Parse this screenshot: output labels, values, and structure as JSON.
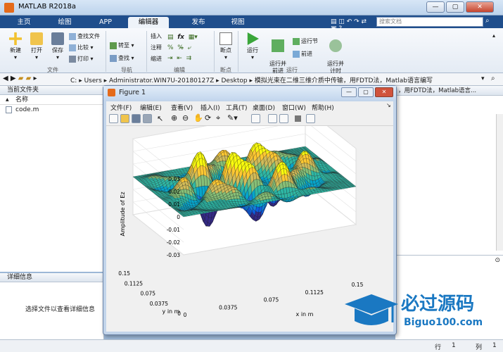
{
  "window": {
    "title": "MATLAB R2018a"
  },
  "tabs": [
    {
      "label": "主页"
    },
    {
      "label": "绘图"
    },
    {
      "label": "APP"
    },
    {
      "label": "编辑器"
    },
    {
      "label": "发布"
    },
    {
      "label": "视图"
    }
  ],
  "search": {
    "placeholder": "搜索文档"
  },
  "ribbon": {
    "file": {
      "new": "新建",
      "open": "打开",
      "save": "保存",
      "find_files": "查找文件",
      "compare": "比较",
      "print": "打印",
      "group": "文件"
    },
    "nav": {
      "goto": "转至",
      "find": "查找",
      "group": "导航"
    },
    "edit": {
      "insert": "插入",
      "comment": "注释",
      "indent": "缩进",
      "fx": "fx",
      "group": "编辑"
    },
    "breakpoints": {
      "label": "断点",
      "group": "断点"
    },
    "run": {
      "run": "运行",
      "run_advance": "运行并\n前进",
      "run_section": "运行节",
      "advance": "前进",
      "run_time": "运行并\n计时",
      "group": "运行"
    }
  },
  "address": {
    "segments": [
      "C:",
      "Users",
      "Administrator.WIN7U-20180127Z",
      "Desktop",
      "模拟光束在二维三维介质中传输，用FDTD法，Matlab语言编写"
    ]
  },
  "left_panel": {
    "title": "当前文件夹",
    "col_name": "名称",
    "sort_indicator": "▲",
    "file": "code.m",
    "details_title": "详细信息",
    "details_hint": "选择文件以查看详细信息"
  },
  "right_panel": {
    "path_suffix": "，用FDTD法，Matlab语言..."
  },
  "status": {
    "row_label": "行",
    "row_value": "1",
    "col_label": "列",
    "col_value": "1"
  },
  "figure": {
    "title": "Figure 1",
    "menu": [
      "文件(F)",
      "编辑(E)",
      "查看(V)",
      "插入(I)",
      "工具(T)",
      "桌面(D)",
      "窗口(W)",
      "帮助(H)"
    ]
  },
  "chart_data": {
    "type": "surface",
    "zlabel": "Amplitude of Ez",
    "xlabel": "x in m",
    "ylabel": "y in m",
    "z_ticks": [
      "0.03",
      "0.02",
      "0.01",
      "0",
      "-0.01",
      "-0.02",
      "-0.03"
    ],
    "zlim": [
      -0.03,
      0.03
    ],
    "x_ticks": [
      "0",
      "0.0375",
      "0.075",
      "0.1125",
      "0.15"
    ],
    "y_ticks": [
      "0.15",
      "0.1125",
      "0.075",
      "0.0375",
      "0"
    ],
    "xlim": [
      0,
      0.15
    ],
    "ylim": [
      0,
      0.15
    ],
    "colormap": "parula",
    "colors": [
      "#352a87",
      "#0f5cdd",
      "#1481d6",
      "#06a4ca",
      "#2eb7a4",
      "#87bf77",
      "#d1bb59",
      "#fec832",
      "#f9fb0e"
    ]
  },
  "watermark": {
    "brand": "必过源码",
    "url": "Biguo100.com"
  }
}
